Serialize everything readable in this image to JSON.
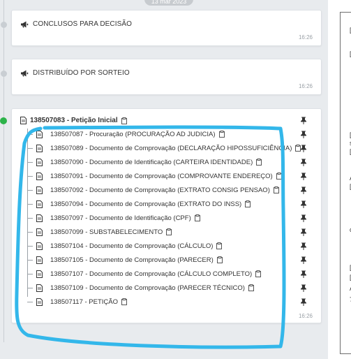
{
  "timeline": {
    "date_pill": "13 mar 2023",
    "events": [
      {
        "title": "CONCLUSOS PARA DECISÃO",
        "time": "16:26",
        "icon": "megaphone-icon"
      },
      {
        "title": "DISTRIBUÍDO POR SORTEIO",
        "time": "16:26",
        "icon": "megaphone-icon"
      }
    ],
    "document": {
      "title": "138507083 - Petição Inicial",
      "time": "16:26",
      "children": [
        "138507087 - Procuração (PROCURAÇÃO AD JUDICIA)",
        "138507089 - Documento de Comprovação (DECLARAÇÃO HIPOSSUFICIÊNCIA)",
        "138507090 - Documento de Identificação (CARTEIRA IDENTIDADE)",
        "138507091 - Documento de Comprovação (COMPROVANTE ENDEREÇO)",
        "138507092 - Documento de Comprovação (EXTRATO CONSIG PENSAO)",
        "138507094 - Documento de Comprovação (EXTRATO DO INSS)",
        "138507097 - Documento de Identificação (CPF)",
        "138507099 - SUBSTABELECIMENTO",
        "138507104 - Documento de Comprovação (CÁLCULO)",
        "138507105 - Documento de Comprovação (PARECER)",
        "138507107 - Documento de Comprovação (CÁLCULO COMPLETO)",
        "138507109 - Documento de Comprovação (PARECER TÉCNICO)",
        "138507117 - PETIÇÃO"
      ]
    }
  },
  "right_panel": {
    "chars": [
      "[",
      "[",
      "[",
      "s",
      "[",
      "A",
      "[",
      "c",
      "[",
      "[",
      "A",
      "7"
    ]
  },
  "colors": {
    "active_dot": "#2db34a",
    "annotation": "#33b7ea"
  }
}
